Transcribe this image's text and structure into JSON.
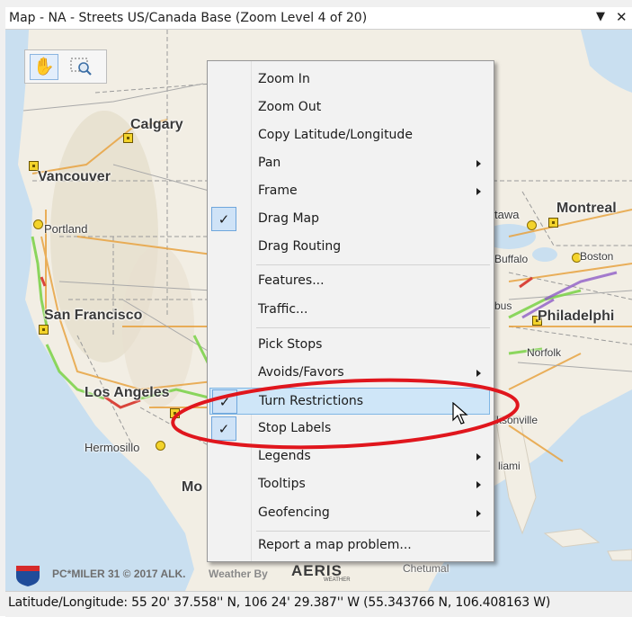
{
  "window": {
    "title": "Map - NA - Streets US/Canada Base (Zoom Level 4 of 20)",
    "dropdown_icon": "chevron-down-icon",
    "close_icon": "close-icon"
  },
  "toolbar": {
    "pan_tool_icon": "hand-icon",
    "zoom_rect_tool_icon": "zoom-rect-icon"
  },
  "map": {
    "cities": [
      {
        "name": "Calgary"
      },
      {
        "name": "Vancouver"
      },
      {
        "name": "Portland"
      },
      {
        "name": "San Francisco"
      },
      {
        "name": "Los Angeles"
      },
      {
        "name": "Hermosillo"
      },
      {
        "name": "Mo"
      },
      {
        "name": "tawa"
      },
      {
        "name": "Montreal"
      },
      {
        "name": "Buffalo"
      },
      {
        "name": "Boston"
      },
      {
        "name": "bus"
      },
      {
        "name": "Philadelphi"
      },
      {
        "name": "Norfolk"
      },
      {
        "name": "ksonville"
      },
      {
        "name": "liami"
      },
      {
        "name": "Chetumal"
      }
    ],
    "attribution": {
      "pcmiler": "PC*MILER 31  © 2017 ALK.",
      "weather_by": "Weather By",
      "aeris": "AERIS",
      "aeris_sub": "WEATHER"
    }
  },
  "context_menu": {
    "items": [
      {
        "label": "Zoom In",
        "checked": false,
        "submenu": false
      },
      {
        "label": "Zoom Out",
        "checked": false,
        "submenu": false
      },
      {
        "label": "Copy Latitude/Longitude",
        "checked": false,
        "submenu": false
      },
      {
        "label": "Pan",
        "checked": false,
        "submenu": true
      },
      {
        "label": "Frame",
        "checked": false,
        "submenu": true
      },
      {
        "label": "Drag Map",
        "checked": true,
        "submenu": false
      },
      {
        "label": "Drag Routing",
        "checked": false,
        "submenu": false
      },
      {
        "label": "Features...",
        "checked": false,
        "submenu": false
      },
      {
        "label": "Traffic...",
        "checked": false,
        "submenu": false
      },
      {
        "label": "Pick Stops",
        "checked": false,
        "submenu": false
      },
      {
        "label": "Avoids/Favors",
        "checked": false,
        "submenu": true
      },
      {
        "label": "Turn Restrictions",
        "checked": true,
        "submenu": false,
        "highlighted": true
      },
      {
        "label": "Stop Labels",
        "checked": true,
        "submenu": false
      },
      {
        "label": "Legends",
        "checked": false,
        "submenu": true
      },
      {
        "label": "Tooltips",
        "checked": false,
        "submenu": true
      },
      {
        "label": "Geofencing",
        "checked": false,
        "submenu": true
      },
      {
        "label": "Report a map problem...",
        "checked": false,
        "submenu": false
      }
    ],
    "check_glyph": "✓"
  },
  "status_bar": {
    "lat_long": "Latitude/Longitude: 55 20' 37.558'' N, 106 24' 29.387'' W (55.343766 N, 106.408163 W)"
  },
  "annotation": {
    "ellipse_color": "#e0161d"
  }
}
